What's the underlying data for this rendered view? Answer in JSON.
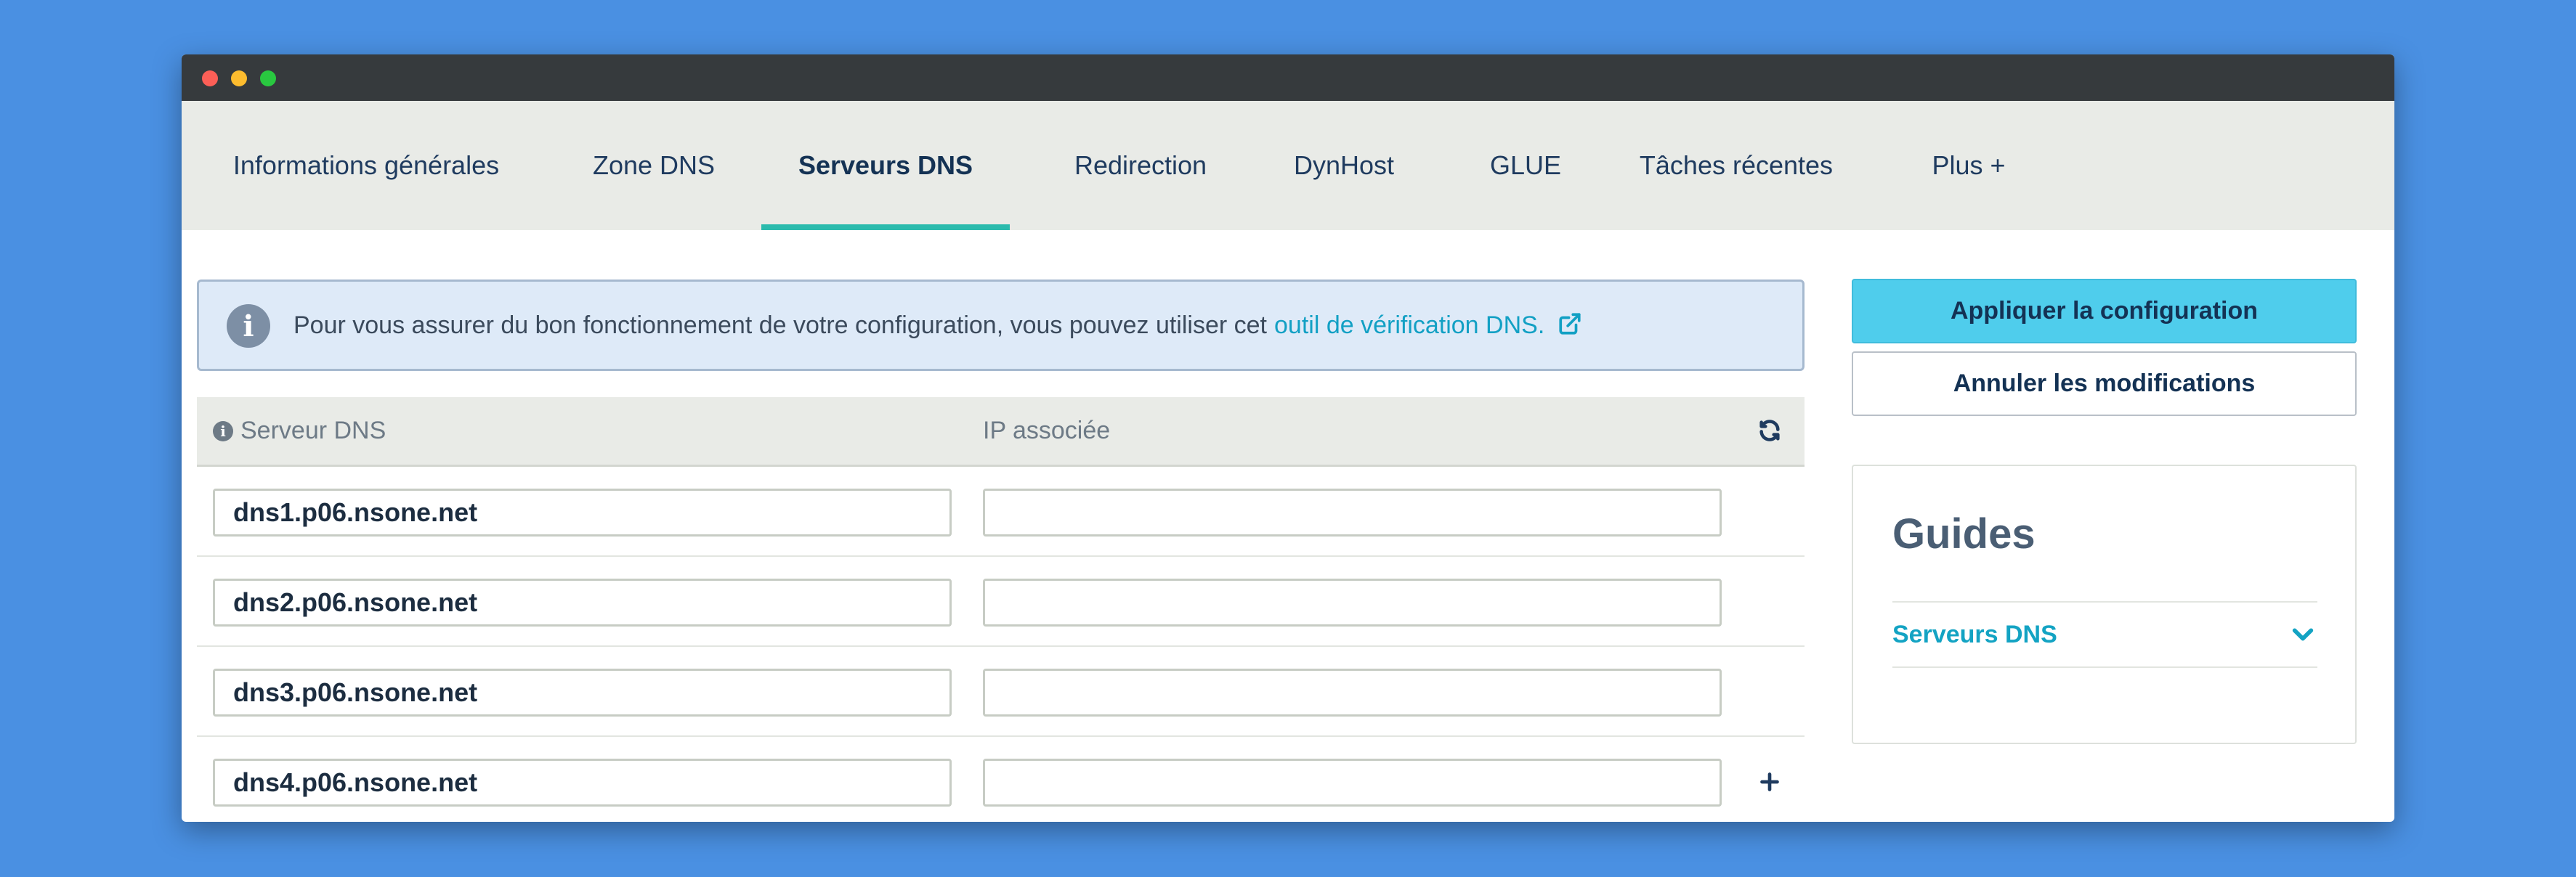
{
  "window": {
    "controls": [
      "close",
      "minimize",
      "maximize"
    ]
  },
  "tabs": [
    {
      "label": "Informations générales",
      "active": false
    },
    {
      "label": "Zone DNS",
      "active": false
    },
    {
      "label": "Serveurs DNS",
      "active": true
    },
    {
      "label": "Redirection",
      "active": false
    },
    {
      "label": "DynHost",
      "active": false
    },
    {
      "label": "GLUE",
      "active": false
    },
    {
      "label": "Tâches récentes",
      "active": false
    },
    {
      "label": "Plus +",
      "active": false
    }
  ],
  "alert": {
    "icon": "info-icon",
    "text": "Pour vous assurer du bon fonctionnement de votre configuration, vous pouvez utiliser cet",
    "link_text": "outil de vérification DNS.",
    "link_icon": "external-link-icon"
  },
  "table": {
    "columns": {
      "dns_server": "Serveur DNS",
      "ip": "IP associée"
    },
    "refresh_icon": "refresh-icon",
    "add_icon": "plus-icon",
    "rows": [
      {
        "dns": "dns1.p06.nsone.net",
        "ip": ""
      },
      {
        "dns": "dns2.p06.nsone.net",
        "ip": ""
      },
      {
        "dns": "dns3.p06.nsone.net",
        "ip": ""
      },
      {
        "dns": "dns4.p06.nsone.net",
        "ip": ""
      }
    ]
  },
  "actions": {
    "apply_label": "Appliquer la configuration",
    "cancel_label": "Annuler les modifications"
  },
  "guides": {
    "title": "Guides",
    "items": [
      {
        "label": "Serveurs DNS",
        "icon": "chevron-down-icon"
      }
    ]
  },
  "colors": {
    "background": "#4a90e2",
    "titlebar": "#363a3d",
    "tab_bar": "#e9ebe7",
    "active_tab_underline": "#2bbbad",
    "primary_button": "#4fcdec",
    "link": "#12a0c4",
    "alert_bg": "#deeaf8"
  }
}
